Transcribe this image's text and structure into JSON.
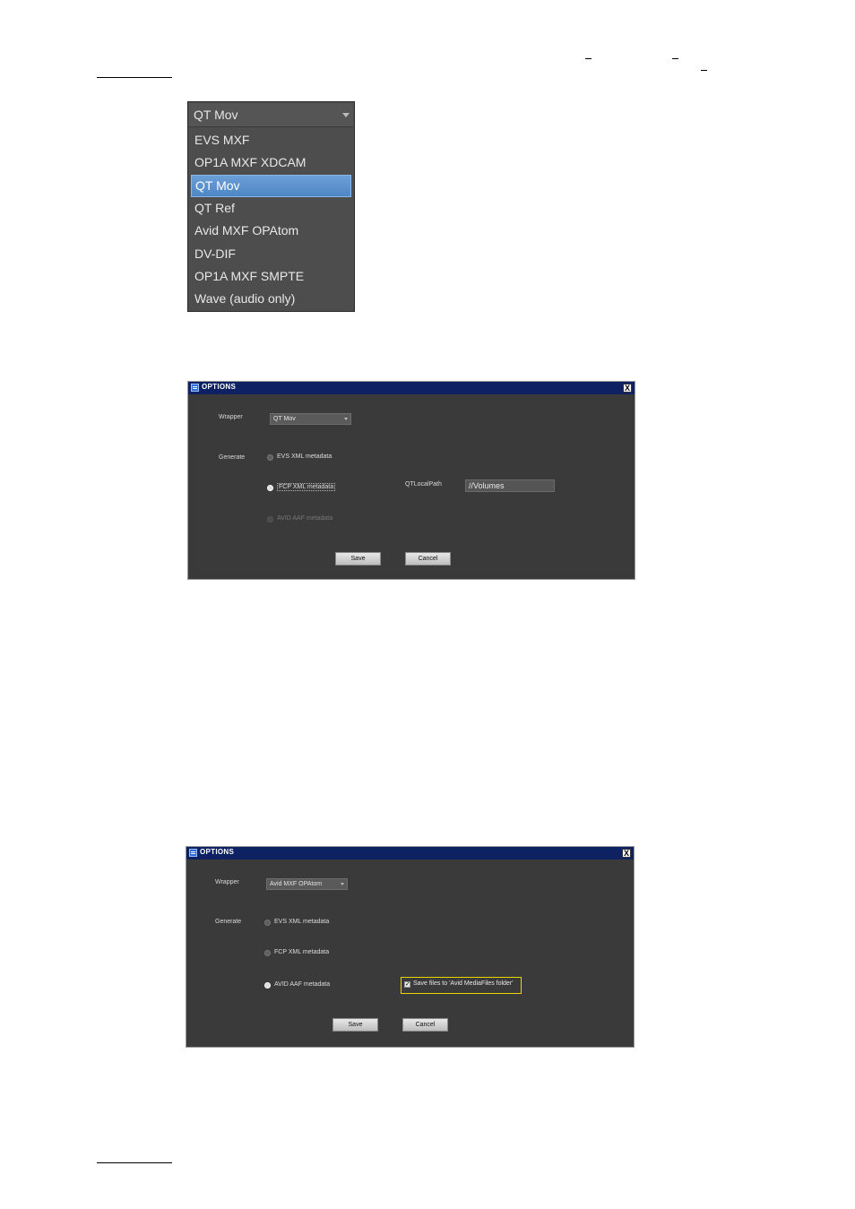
{
  "dropdown": {
    "selected": "QT Mov",
    "items": [
      "EVS MXF",
      "OP1A MXF XDCAM",
      "QT Mov",
      "QT Ref",
      "Avid MXF OPAtom",
      "DV-DIF",
      "OP1A MXF SMPTE",
      "Wave (audio only)"
    ]
  },
  "dialog1": {
    "title": "OPTIONS",
    "close": "X",
    "wrapper_label": "Wrapper",
    "wrapper_value": "QT Mov",
    "generate_label": "Generate",
    "options": [
      "EVS XML metadata",
      "FCP XML metadata",
      "AVID AAF metadata"
    ],
    "selected_option": "FCP XML metadata",
    "path_label": "QTLocalPath",
    "path_value": "//Volumes",
    "save": "Save",
    "cancel": "Cancel"
  },
  "dialog2": {
    "title": "OPTIONS",
    "close": "X",
    "wrapper_label": "Wrapper",
    "wrapper_value": "Avid MXF OPAtom",
    "generate_label": "Generate",
    "options": [
      "EVS XML metadata",
      "FCP XML metadata",
      "AVID AAF metadata"
    ],
    "selected_option": "AVID AAF metadata",
    "checkbox_label": "Save files to 'Avid MediaFiles folder'",
    "checkbox_checked": true,
    "checkbox_mark": "✓",
    "save": "Save",
    "cancel": "Cancel"
  },
  "colors": {
    "dialog_bg": "#3a3a3a",
    "titlebar": "#0d2163",
    "selection": "#5a92d0",
    "highlight_border": "#e6d800"
  }
}
